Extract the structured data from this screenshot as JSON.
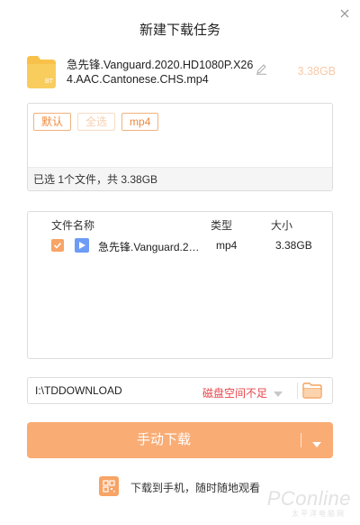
{
  "dialog": {
    "title": "新建下载任务"
  },
  "file": {
    "icon_label": "BT",
    "name": "急先锋.Vanguard.2020.HD1080P.X264.AAC.Cantonese.CHS.mp4",
    "total_size": "3.38GB"
  },
  "filters": {
    "chips": [
      "默认",
      "全选",
      "mp4"
    ],
    "summary": "已选 1个文件，共 3.38GB"
  },
  "table": {
    "headers": {
      "name": "文件名称",
      "type": "类型",
      "size": "大小"
    },
    "rows": [
      {
        "checked": true,
        "name": "急先锋.Vanguard.2020.HD1080P.X264.AAC.Cantonese.CHS.mp4",
        "type": "mp4",
        "size": "3.38GB"
      }
    ]
  },
  "path": {
    "value": "I:\\TDDOWNLOAD",
    "warning": "磁盘空间不足"
  },
  "actions": {
    "download_label": "手动下载",
    "mobile_text": "下载到手机，随时随地观看"
  },
  "watermark": {
    "brand": "PConline",
    "sub": "太平洋电脑网"
  },
  "colors": {
    "accent": "#f9ac74",
    "warning": "#e8464b",
    "video": "#6e9bf5"
  }
}
